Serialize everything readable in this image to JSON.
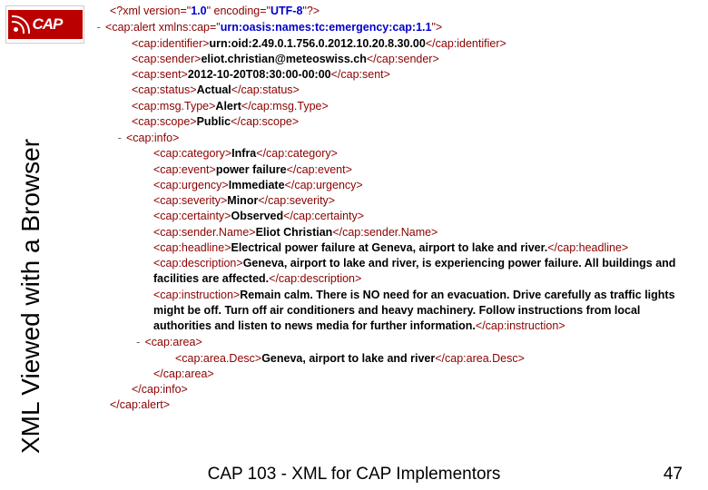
{
  "logo_text": "CAP",
  "vertical_title": "XML Viewed with a Browser",
  "footer": "CAP 103 - XML for CAP Implementors",
  "pagenum": "47",
  "decl_version": "1.0",
  "decl_encoding": "UTF-8",
  "xmlns_val": "urn:oasis:names:tc:emergency:cap:1.1",
  "identifier": "urn:oid:2.49.0.1.756.0.2012.10.20.8.30.00",
  "sender": "eliot.christian@meteoswiss.ch",
  "sent": "2012-10-20T08:30:00-00:00",
  "status": "Actual",
  "msgtype": "Alert",
  "scope": "Public",
  "category": "Infra",
  "event": "power failure",
  "urgency": "Immediate",
  "severity": "Minor",
  "certainty": "Observed",
  "sendername": "Eliot Christian",
  "headline": "Electrical power failure at Geneva, airport to lake and river.",
  "description": "Geneva, airport to lake and river, is experiencing power failure. All buildings and facilities are affected.",
  "instruction": "Remain calm. There is NO need for an evacuation. Drive carefully as traffic lights might be off. Turn off air conditioners and heavy machinery. Follow instructions from local authorities and listen to news media for further information.",
  "areadesc": "Geneva, airport to lake and river"
}
